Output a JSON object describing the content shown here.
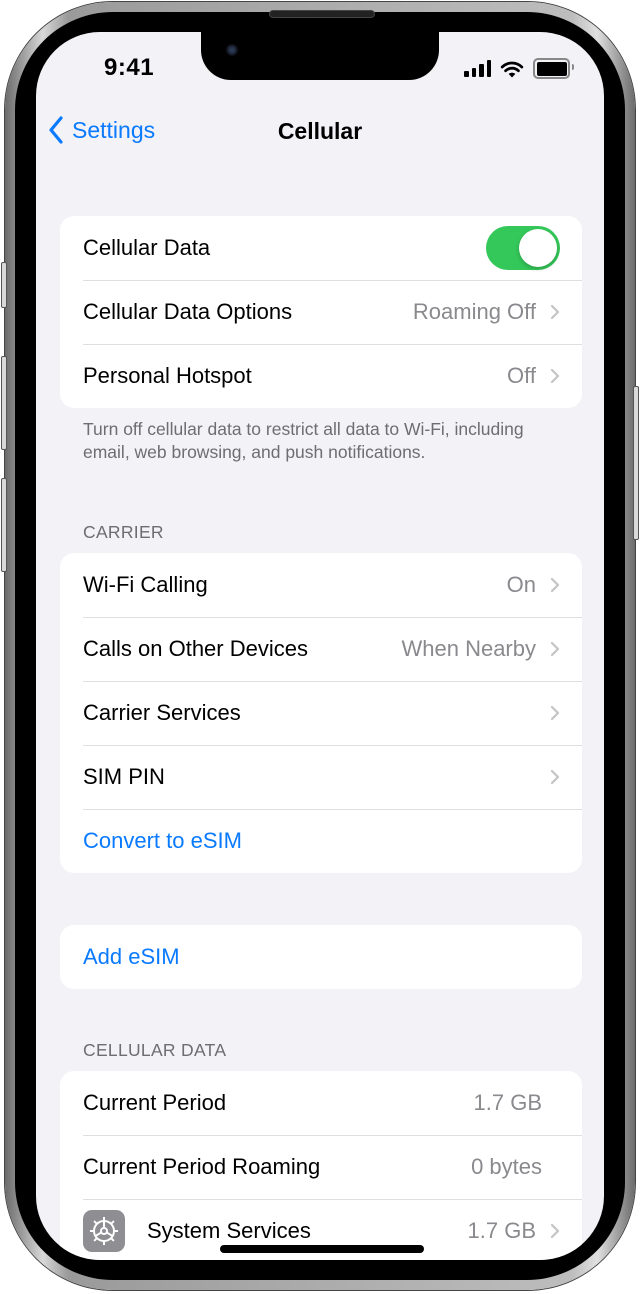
{
  "status_bar": {
    "time": "9:41",
    "icons": [
      "cellular-signal-icon",
      "wifi-icon",
      "battery-icon"
    ]
  },
  "nav": {
    "back_label": "Settings",
    "back_icon": "chevron-left-icon",
    "title": "Cellular"
  },
  "group1": {
    "rows": [
      {
        "label": "Cellular Data",
        "control": "toggle",
        "toggle_on": true
      },
      {
        "label": "Cellular Data Options",
        "value": "Roaming Off",
        "chevron": true
      },
      {
        "label": "Personal Hotspot",
        "value": "Off",
        "chevron": true
      }
    ],
    "footer": "Turn off cellular data to restrict all data to Wi-Fi, including email, web browsing, and push notifications."
  },
  "carrier": {
    "header": "CARRIER",
    "rows": [
      {
        "label": "Wi-Fi Calling",
        "value": "On",
        "chevron": true
      },
      {
        "label": "Calls on Other Devices",
        "value": "When Nearby",
        "chevron": true
      },
      {
        "label": "Carrier Services",
        "value": "",
        "chevron": true
      },
      {
        "label": "SIM PIN",
        "value": "",
        "chevron": true
      },
      {
        "label": "Convert to eSIM",
        "style": "link"
      }
    ]
  },
  "esim": {
    "add_label": "Add eSIM"
  },
  "cellular_data": {
    "header": "CELLULAR DATA",
    "rows": [
      {
        "label": "Current Period",
        "value": "1.7 GB"
      },
      {
        "label": "Current Period Roaming",
        "value": "0 bytes"
      },
      {
        "label": "System Services",
        "value": "1.7 GB",
        "chevron": true,
        "icon": "gear-icon"
      }
    ]
  },
  "colors": {
    "accent": "#0a7aff",
    "toggle_on": "#34c759",
    "background": "#f2f2f7",
    "secondary_text": "#8a8a8e"
  }
}
